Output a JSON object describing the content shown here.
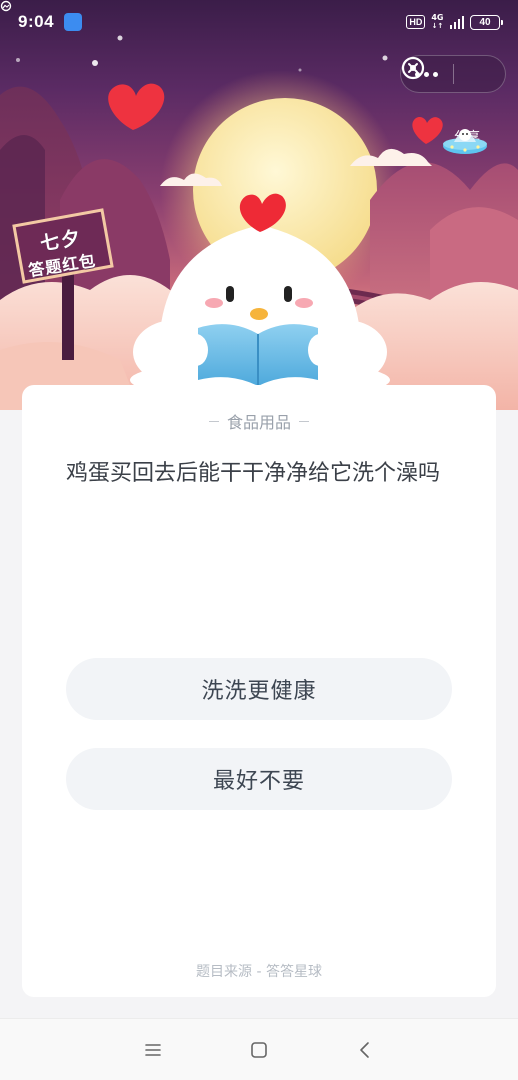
{
  "status_bar": {
    "time": "9:04",
    "hd_label": "HD",
    "network_label": "4G",
    "battery_level": "40"
  },
  "banner": {
    "sign_line_1": "七夕",
    "sign_line_2": "答题红包",
    "share_label": "分享"
  },
  "quiz": {
    "category": "食品用品",
    "question": "鸡蛋买回去后能干干净净给它洗个澡吗",
    "options": [
      {
        "label": "洗洗更健康"
      },
      {
        "label": "最好不要"
      }
    ],
    "source": "题目来源 - 答答星球"
  },
  "colors": {
    "banner_top": "#3b1d49",
    "banner_bottom": "#f7cdbf",
    "card_bg": "#ffffff",
    "option_bg": "#f2f4f7",
    "text_primary": "#3b4048",
    "text_muted": "#9aa1ab",
    "heart_red": "#ee3340"
  },
  "icons": {
    "notification": "gallery-app-icon",
    "more": "more-dots-icon",
    "close": "close-circle-icon",
    "share": "ufo-share-icon",
    "nav_menu": "menu-lines-icon",
    "nav_home": "home-square-icon",
    "nav_back": "back-chevron-icon"
  }
}
